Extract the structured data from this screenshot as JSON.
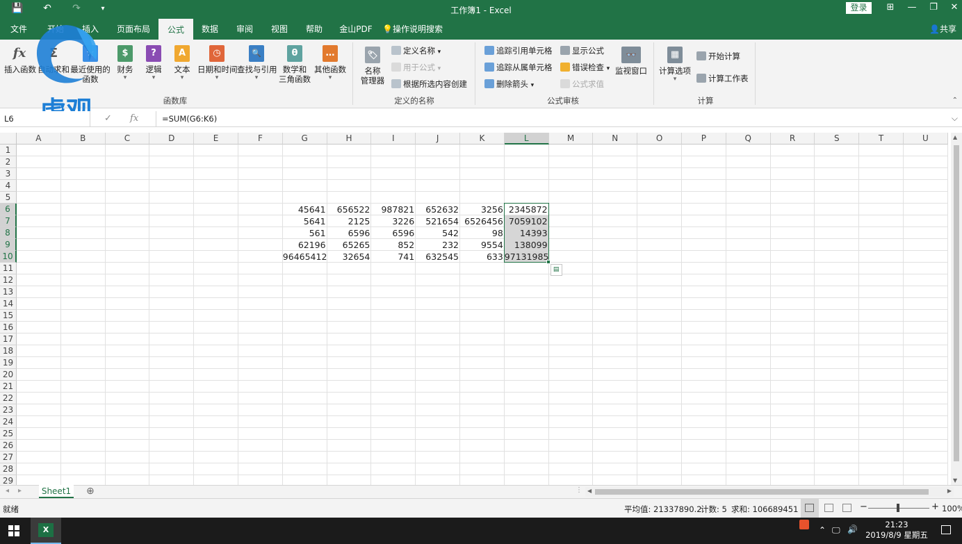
{
  "window": {
    "title": "工作簿1 - Excel",
    "login": "登录",
    "share": "共享",
    "qa_save": "💾",
    "qa_undo": "↶",
    "qa_redo": "↷",
    "qa_more": "▾",
    "win_ribbon_display": "⊞",
    "win_min": "—",
    "win_restore": "❐",
    "win_close": "✕"
  },
  "tabs": [
    {
      "label": "文件"
    },
    {
      "label": "开始"
    },
    {
      "label": "插入"
    },
    {
      "label": "页面布局"
    },
    {
      "label": "公式"
    },
    {
      "label": "数据"
    },
    {
      "label": "审阅"
    },
    {
      "label": "视图"
    },
    {
      "label": "帮助"
    },
    {
      "label": "金山PDF"
    },
    {
      "label": "操作说明搜索"
    }
  ],
  "ribbon": {
    "insert_function": "插入函数",
    "autosum": "自动求和",
    "recent": "最近使用的\n函数",
    "finance": "财务",
    "logic": "逻辑",
    "text": "文本",
    "datetime": "日期和时间",
    "lookup": "查找与引用",
    "math": "数学和\n三角函数",
    "other": "其他函数",
    "group_library": "函数库",
    "name_manager": "名称\n管理器",
    "define_name": "定义名称",
    "use_in_formula": "用于公式",
    "create_from_selection": "根据所选内容创建",
    "group_names": "定义的名称",
    "trace_precedents": "追踪引用单元格",
    "trace_dependents": "追踪从属单元格",
    "remove_arrows": "删除箭头",
    "show_formulas": "显示公式",
    "error_checking": "错误检查",
    "evaluate_formula": "公式求值",
    "watch_window": "监视窗口",
    "group_auditing": "公式审核",
    "calc_options": "计算选项",
    "calc_now": "开始计算",
    "calc_sheet": "计算工作表",
    "group_calc": "计算",
    "fx_glyph": "fx",
    "finance_icon": "$",
    "logic_icon": "?",
    "text_icon": "A",
    "datetime_icon": "◷",
    "lookup_icon": "🔍",
    "math_icon": "θ",
    "other_icon": "…",
    "name_icon": "🏷",
    "watch_icon": "👓",
    "calc_icon": "▦",
    "caret": "▾"
  },
  "formula_bar": {
    "name_box": "L6",
    "cancel": "✓",
    "fx": "fx",
    "formula": "=SUM(G6:K6)",
    "expand": "⌵"
  },
  "columns": [
    "A",
    "B",
    "C",
    "D",
    "E",
    "F",
    "G",
    "H",
    "I",
    "J",
    "K",
    "L",
    "M",
    "N",
    "O",
    "P",
    "Q",
    "R",
    "S",
    "T",
    "U"
  ],
  "rows": [
    "1",
    "2",
    "3",
    "4",
    "5",
    "6",
    "7",
    "8",
    "9",
    "10",
    "11",
    "12",
    "13",
    "14",
    "15",
    "16",
    "17",
    "18",
    "19",
    "20",
    "21",
    "22",
    "23",
    "24",
    "25",
    "26",
    "27",
    "28",
    "29"
  ],
  "cells": [
    [
      "45641",
      "656522",
      "987821",
      "652632",
      "3256",
      "2345872"
    ],
    [
      "5641",
      "2125",
      "3226",
      "521654",
      "6526456",
      "7059102"
    ],
    [
      "561",
      "6596",
      "6596",
      "542",
      "98",
      "14393"
    ],
    [
      "62196",
      "65265",
      "852",
      "232",
      "9554",
      "138099"
    ],
    [
      "96465412",
      "32654",
      "741",
      "632545",
      "633",
      "97131985"
    ]
  ],
  "sheet": {
    "tab": "Sheet1",
    "add": "⊕",
    "nav_prev": "◂",
    "nav_next": "▸"
  },
  "status": {
    "ready": "就绪",
    "average": "平均值: 21337890.2",
    "count": "计数: 5",
    "sum": "求和: 106689451",
    "zoom": "100%",
    "zoom_minus": "−",
    "zoom_plus": "+"
  },
  "taskbar": {
    "time": "21:23",
    "date": "2019/8/9 星期五",
    "excel_letter": "X"
  },
  "watermark": {
    "text": "虎观"
  },
  "colors": {
    "accent": "#217346",
    "selection": "#d6d6d6"
  }
}
